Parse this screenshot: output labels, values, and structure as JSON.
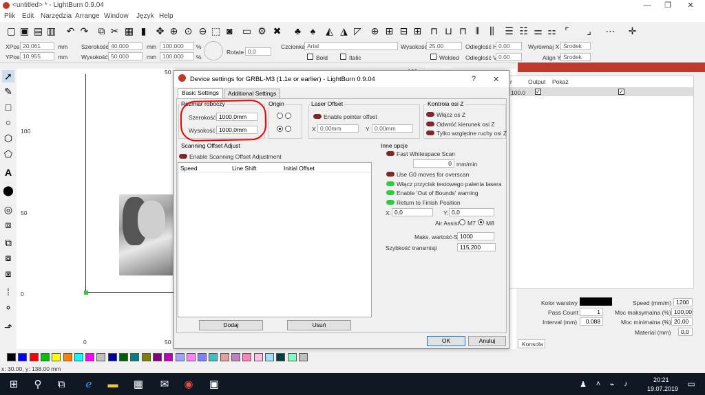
{
  "window": {
    "title": "<untitled> * - LightBurn 0.9.04",
    "minimize": "—",
    "maximize": "❐",
    "close": "✕"
  },
  "menu": [
    "Plik",
    "Edit",
    "Narzędzia",
    "Arrange",
    "Window",
    "Język",
    "Help"
  ],
  "props": {
    "xpos_label": "XPos",
    "xpos_value": "20.061",
    "ypos_label": "YPos",
    "ypos_value": "10.955",
    "unit": "mm",
    "width_label": "Szerokość",
    "width_value": "40.000",
    "height_label": "Wysokość",
    "height_value": "50.000",
    "scale_w": "100.000",
    "scale_h": "100.000",
    "percent": "%",
    "rotate_label": "Rotate",
    "rotate_value": "0,0",
    "font_label": "Czcionka",
    "font_value": "Arial",
    "text_height_label": "Wysokość",
    "text_height_value": "25.00",
    "hspace_label": "Odległość H",
    "hspace_value": "0.00",
    "vspace_label": "Odległość V",
    "vspace_value": "0.00",
    "alignx_label": "Wyrównaj X",
    "alignx_value": "Środek",
    "aligny_label": "Align Y",
    "aligny_value": "Środek",
    "bold_label": "Bold",
    "italic_label": "Italic",
    "welded_label": "Welded"
  },
  "ruler": {
    "top": [
      "0",
      "50",
      "100"
    ],
    "left": [
      "100",
      "50",
      "0"
    ],
    "bottom": [
      "0",
      "50"
    ]
  },
  "dialog": {
    "title": "Device settings for GRBL-M3 (1.1e or earlier) - LightBurn 0.9.04",
    "help": "?",
    "close": "✕",
    "tabs": [
      "Basic Settings",
      "Additional Settings"
    ],
    "size_group": "Rozmiar roboczy",
    "width_label": "Szerokość",
    "width_value": "1000,0mm",
    "height_label": "Wysokość",
    "height_value": "1000,0mm",
    "origin_group": "Origin",
    "laser_offset_group": "Laser Offset",
    "pointer_offset_label": "Enable pointer offset",
    "x_label": "X",
    "x_value": "0,00mm",
    "y_label": "Y",
    "y_value": "0,00mm",
    "zaxis_group": "Kontrola osi Z",
    "z_enable": "Włącz oś Z",
    "z_reverse": "Odwróć kierunek osi Z",
    "z_relative": "Tylko względne ruchy osi Z",
    "scan_group": "Scanning Offset Adjust",
    "scan_enable": "Enable Scanning Offset Adjustment",
    "scan_columns": [
      "Speed",
      "Line Shift",
      "Initial Offset"
    ],
    "add_button": "Dodaj",
    "remove_button": "Usuń",
    "other_group": "Inne opcje",
    "fast_whitespace": "Fast Whitespace Scan",
    "whitespace_value": "0",
    "whitespace_unit": "mm/min",
    "g0_overscan": "Use G0 moves for overscan",
    "test_fire": "Włącz przycisk testowego palenia lasera",
    "out_of_bounds": "Enable 'Out of Bounds' warning",
    "return_finish": "Return to Finish Position",
    "finish_x_label": "X:",
    "finish_x_value": "0,0",
    "finish_y_label": "Y:",
    "finish_y_value": "0,0",
    "air_assist_label": "Air Assist",
    "m7": "M7",
    "m8": "M8",
    "max_s_label": "Maks. wartość-S",
    "max_s_value": "1000",
    "baud_label": "Szybkość transmisji",
    "baud_value": "115,200",
    "ok": "OK",
    "cancel": "Anuluj"
  },
  "right_panel": {
    "header": "Wycinanie",
    "columns": [
      "r",
      "Output",
      "Pokaż"
    ],
    "row_value": "100.0",
    "layer_color_label": "Kolor warstwy",
    "speed_label": "Speed (mm/m)",
    "speed_value": "1200",
    "pass_count_label": "Pass Count",
    "pass_count_value": "1",
    "max_power_label": "Moc maksymalna (%)",
    "max_power_value": "100,00",
    "interval_label": "Interval (mm)",
    "interval_value": "0.088",
    "min_power_label": "Moc minimalna (%)",
    "min_power_value": "20,00",
    "material_label": "Material (mm)",
    "material_value": "0,0",
    "console_tab": "Konsola"
  },
  "palette_colors": [
    "#000000",
    "#0000ff",
    "#ff0000",
    "#00c000",
    "#ffff00",
    "#ff8000",
    "#00ffff",
    "#ff00ff",
    "#c0c0c0",
    "#0000a0",
    "#006000",
    "#008080",
    "#808000",
    "#800080",
    "#c000c0",
    "#a0a0ff",
    "#ff80ff",
    "#8080ff",
    "#40c0c0",
    "#e0a0a0",
    "#c080c0",
    "#ff80c0",
    "#ffc0e0",
    "#a0e0ff",
    "#004040",
    "#80ffc0",
    "#c0c0c0"
  ],
  "status": {
    "coords": "x: 30.00, y: 138.00 mm"
  },
  "taskbar": {
    "time": "20:21",
    "date": "19.07.2019"
  }
}
